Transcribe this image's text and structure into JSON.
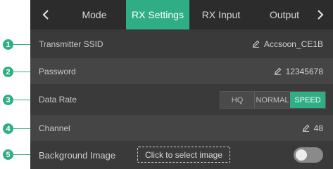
{
  "tabs": [
    {
      "label": "Mode",
      "active": false
    },
    {
      "label": "RX Settings",
      "active": true
    },
    {
      "label": "RX Input",
      "active": false
    },
    {
      "label": "Output",
      "active": false
    }
  ],
  "nav": {
    "prev_icon": "chevron-left-icon",
    "next_icon": "chevron-right-icon"
  },
  "rows": {
    "ssid": {
      "label": "Transmitter SSID",
      "value": "Accsoon_CE1B",
      "icon": "pencil-icon"
    },
    "password": {
      "label": "Password",
      "value": "12345678",
      "icon": "pencil-icon"
    },
    "data_rate": {
      "label": "Data Rate",
      "options": [
        "HQ",
        "NORMAL",
        "SPEED"
      ],
      "selected": "SPEED"
    },
    "channel": {
      "label": "Channel",
      "value": "48",
      "icon": "pencil-icon"
    },
    "background": {
      "label": "Background Image",
      "button": "Click to select image",
      "toggle_on": false
    }
  },
  "callouts": [
    "1",
    "2",
    "3",
    "4",
    "5"
  ],
  "colors": {
    "accent": "#2fae86",
    "panel": "#3a3a3a",
    "tabbar": "#2c2c2c"
  }
}
